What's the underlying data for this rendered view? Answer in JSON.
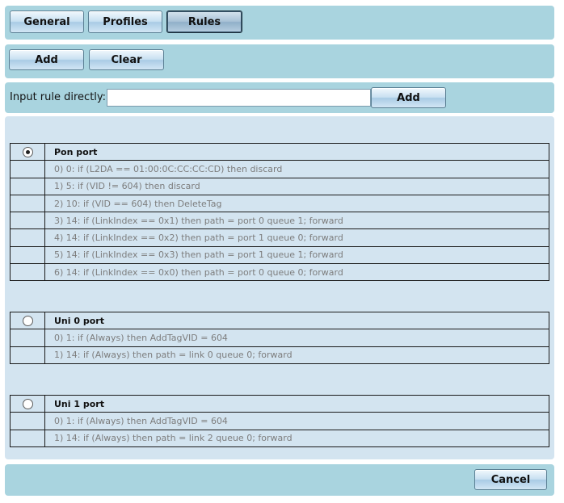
{
  "tabs": [
    {
      "label": "General",
      "active": false
    },
    {
      "label": "Profiles",
      "active": false
    },
    {
      "label": "Rules",
      "active": true
    }
  ],
  "actions": {
    "add_label": "Add",
    "clear_label": "Clear"
  },
  "direct_input": {
    "label": "Input rule directly:",
    "value": "",
    "placeholder": "",
    "add_label": "Add"
  },
  "ports": [
    {
      "name": "Pon port",
      "selected": true,
      "rules": [
        "0) 0: if (L2DA == 01:00:0C:CC:CC:CD) then discard",
        "1) 5: if (VID != 604) then discard",
        "2) 10: if (VID == 604) then DeleteTag",
        "3) 14: if (LinkIndex == 0x1) then path = port 0 queue 1; forward",
        "4) 14: if (LinkIndex == 0x2) then path = port 1 queue 0; forward",
        "5) 14: if (LinkIndex == 0x3) then path = port 1 queue 1; forward",
        "6) 14: if (LinkIndex == 0x0) then path = port 0 queue 0; forward"
      ]
    },
    {
      "name": "Uni 0 port",
      "selected": false,
      "rules": [
        "0) 1: if (Always) then AddTagVID = 604",
        "1) 14: if (Always) then path = link 0 queue 0; forward"
      ]
    },
    {
      "name": "Uni 1 port",
      "selected": false,
      "rules": [
        "0) 1: if (Always) then AddTagVID = 604",
        "1) 14: if (Always) then path = link 2 queue 0; forward"
      ]
    }
  ],
  "footer": {
    "cancel_label": "Cancel"
  }
}
